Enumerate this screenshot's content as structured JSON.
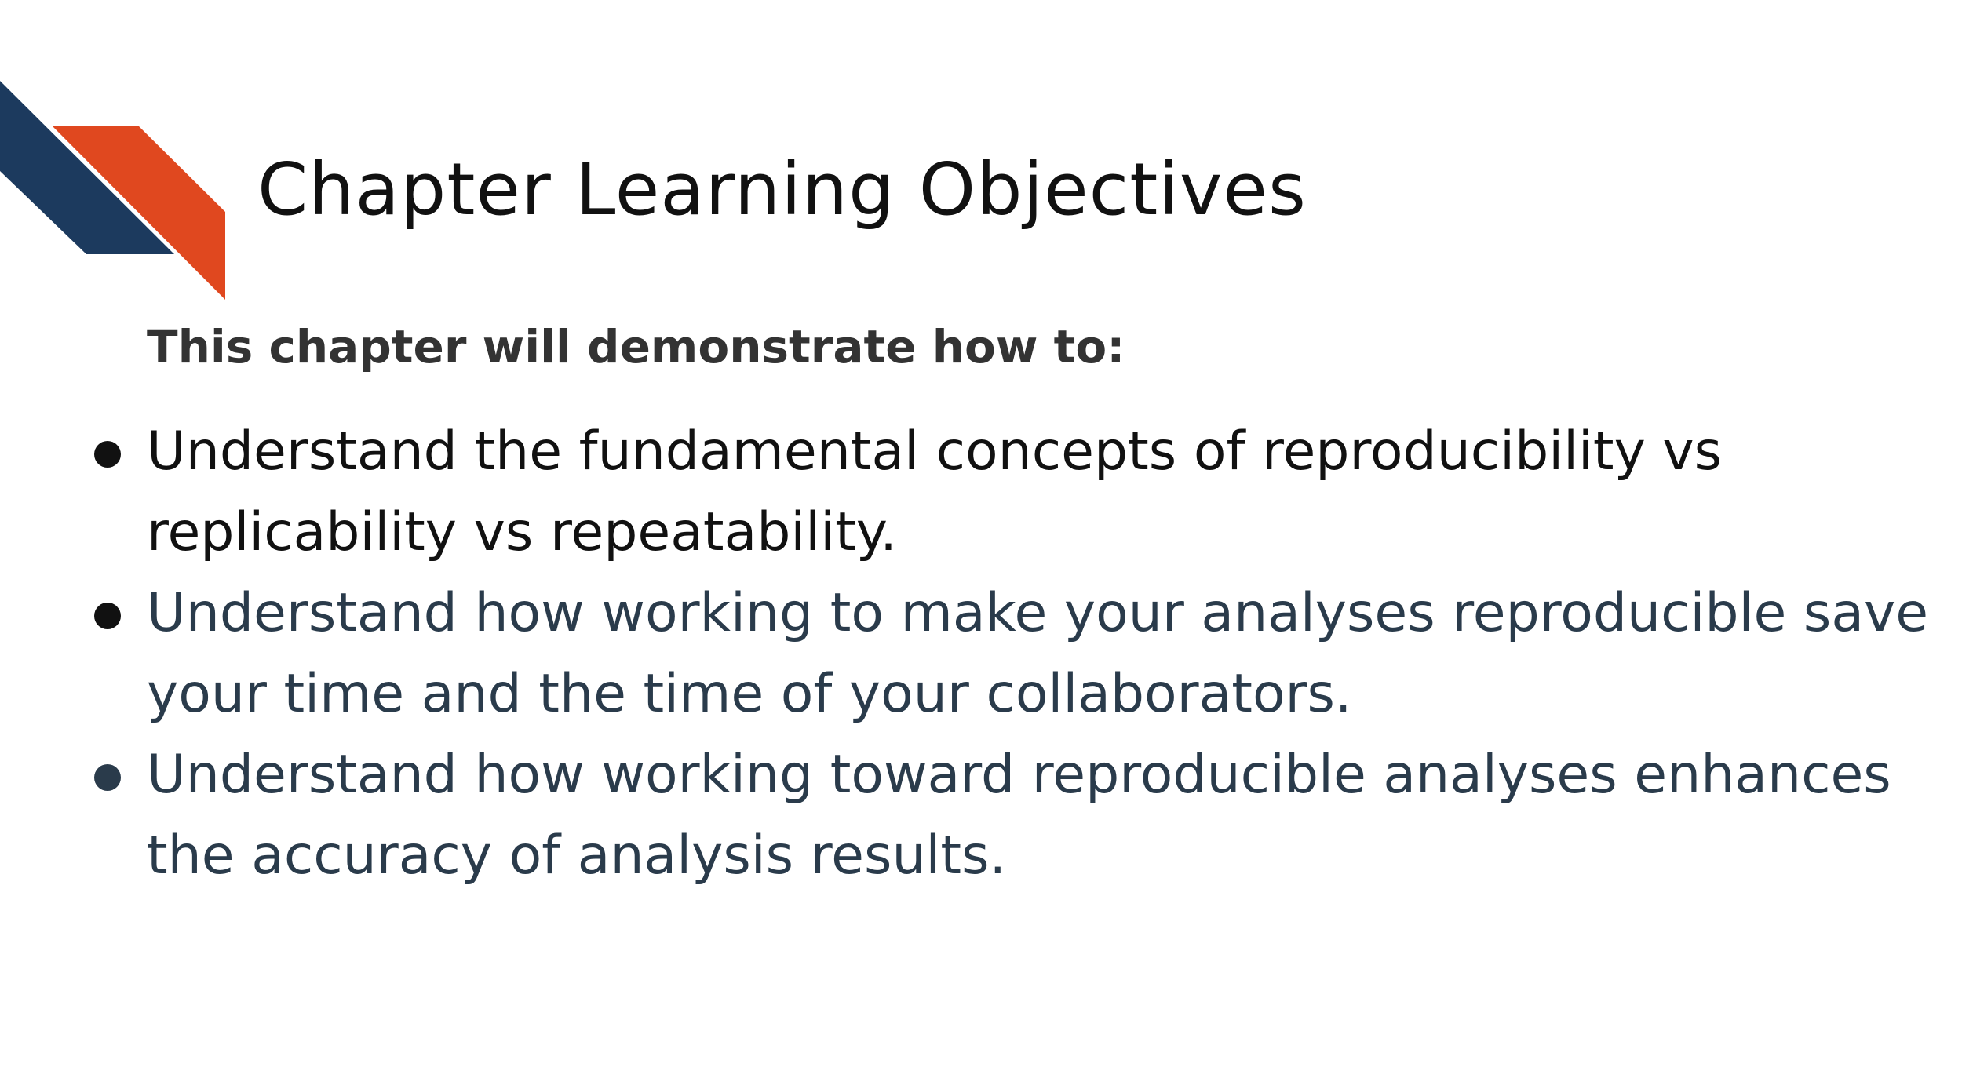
{
  "slide": {
    "title": "Chapter Learning Objectives",
    "intro": "This chapter will demonstrate how to:",
    "objectives": [
      {
        "text": "Understand the fundamental concepts of reproducibility vs replicability vs repeatability.",
        "color": "#111111"
      },
      {
        "text": "Understand how working to make your analyses reproducible save your time and the time of your collaborators.",
        "color": "#2a3b4b"
      },
      {
        "text": "Understand how working toward reproducible analyses enhances the accuracy of analysis results.",
        "color": "#2a3b4b"
      }
    ]
  },
  "colors": {
    "navy_stripe": "#1c3a5e",
    "orange_stripe": "#e0481f",
    "title_text": "#111111",
    "intro_text": "#333333"
  }
}
